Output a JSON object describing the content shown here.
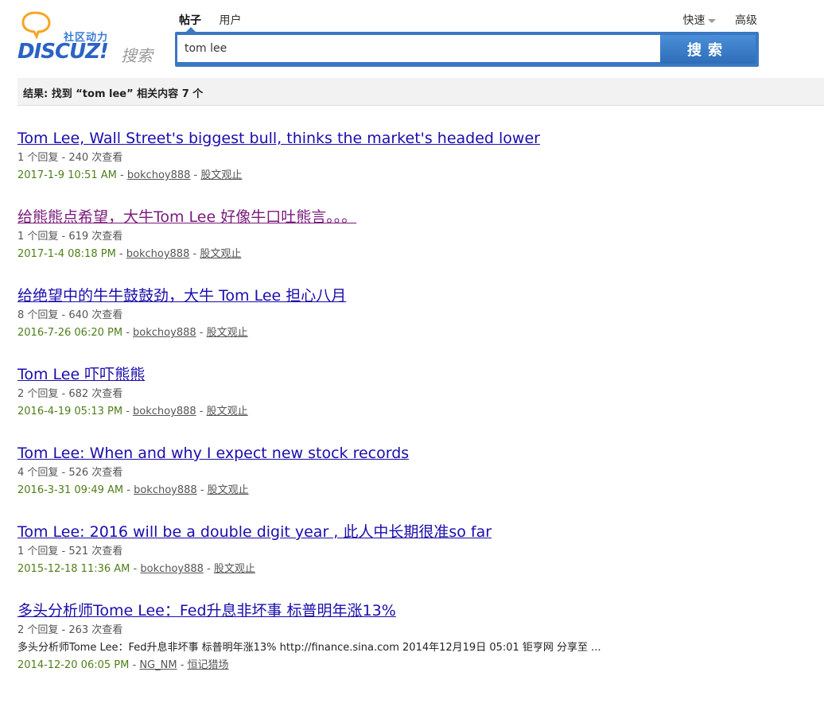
{
  "logo": {
    "cn": "社区动力",
    "en": "DISCUZ!",
    "sou": "搜索"
  },
  "tabs": [
    {
      "label": "帖子",
      "active": true
    },
    {
      "label": "用户",
      "active": false
    }
  ],
  "toplinks": {
    "quick": "快速",
    "advanced": "高级"
  },
  "search": {
    "value": "tom lee",
    "button": "搜索"
  },
  "summary": "结果: 找到 “tom lee” 相关内容 7 个",
  "colors": {
    "accent": "#3a78c3",
    "link": "#1a0dab",
    "visited": "#7a1a7a",
    "date": "#4e7f19"
  },
  "results": [
    {
      "title": "Tom Lee, Wall Street's biggest bull, thinks the market's headed lower",
      "visited": false,
      "stats": "1 个回复 - 240 次查看",
      "date": "2017-1-9 10:51 AM",
      "author": "bokchoy888",
      "forum": "股文观止"
    },
    {
      "title": "给熊熊点希望，大牛Tom Lee 好像牛口吐熊言。。。",
      "visited": true,
      "stats": "1 个回复 - 619 次查看",
      "date": "2017-1-4 08:18 PM",
      "author": "bokchoy888",
      "forum": "股文观止"
    },
    {
      "title": "给绝望中的牛牛鼓鼓劲，大牛 Tom Lee 担心八月",
      "visited": false,
      "stats": "8 个回复 - 640 次查看",
      "date": "2016-7-26 06:20 PM",
      "author": "bokchoy888",
      "forum": "股文观止"
    },
    {
      "title": "Tom Lee 吓吓熊熊",
      "visited": false,
      "stats": "2 个回复 - 682 次查看",
      "date": "2016-4-19 05:13 PM",
      "author": "bokchoy888",
      "forum": "股文观止"
    },
    {
      "title": "Tom Lee: When and why I expect new stock records",
      "visited": false,
      "stats": "4 个回复 - 526 次查看",
      "date": "2016-3-31 09:49 AM",
      "author": "bokchoy888",
      "forum": "股文观止"
    },
    {
      "title": "Tom Lee: 2016 will be a double digit year , 此人中长期很准so far",
      "visited": false,
      "stats": "1 个回复 - 521 次查看",
      "date": "2015-12-18 11:36 AM",
      "author": "bokchoy888",
      "forum": "股文观止"
    },
    {
      "title": "多头分析师Tome Lee：Fed升息非坏事 标普明年涨13%",
      "visited": false,
      "stats": "2 个回复 - 263 次查看",
      "snippet": "多头分析师Tome Lee：Fed升息非坏事 标普明年涨13% http://finance.sina.com   2014年12月19日 05:01   钜亨网 分享至 ...",
      "date": "2014-12-20 06:05 PM",
      "author": "NG_NM",
      "forum": "恒记猎场"
    }
  ]
}
